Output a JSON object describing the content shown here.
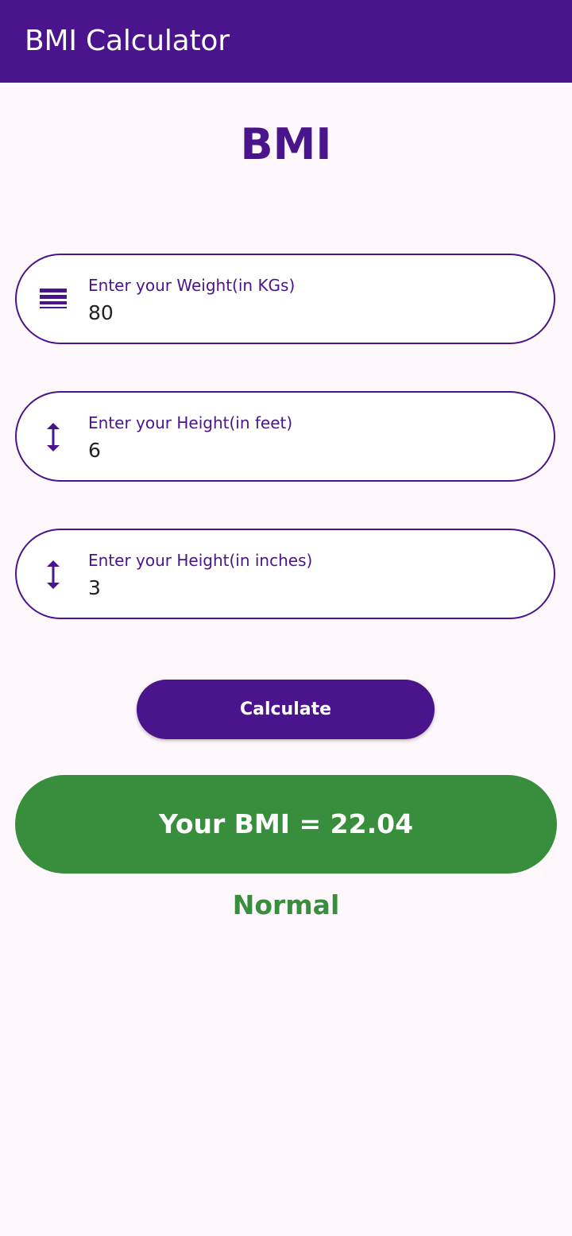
{
  "app_bar": {
    "title": "BMI Calculator",
    "color": "#4a148c"
  },
  "main": {
    "heading": "BMI",
    "fields": [
      {
        "label": "Enter your Weight(in KGs)",
        "value": "80",
        "icon": "weight-lines-icon"
      },
      {
        "label": "Enter your Height(in feet)",
        "value": "6",
        "icon": "height-arrow-icon"
      },
      {
        "label": "Enter your Height(in inches)",
        "value": "3",
        "icon": "height-arrow-icon"
      }
    ],
    "calculate_label": "Calculate",
    "result_text": "Your BMI = 22.04",
    "status_text": "Normal",
    "result_color": "#388e3c"
  }
}
